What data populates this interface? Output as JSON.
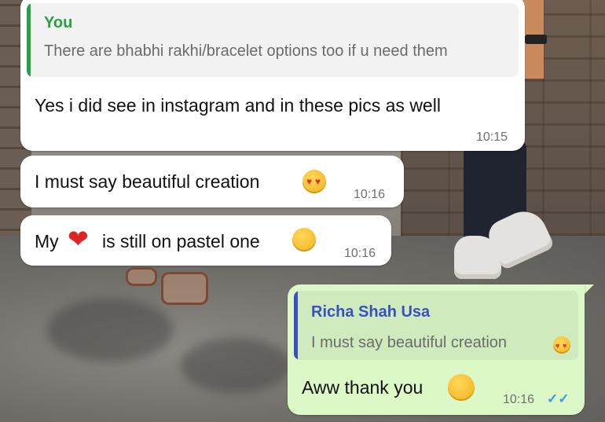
{
  "messages": [
    {
      "quote_author": "You",
      "quote_text": "There are bhabhi rakhi/bracelet options too if u need them",
      "text": "Yes i did see in instagram and in these pics as well",
      "time": "10:15"
    },
    {
      "text": "I must say beautiful creation",
      "emoji": "heart-eyes-emoji",
      "time": "10:16"
    },
    {
      "text_before": "My",
      "heart": "❤",
      "text_after": "is still on pastel one",
      "emoji": "shy-emoji",
      "time": "10:16"
    },
    {
      "quote_author": "Richa Shah Usa",
      "quote_text": "I must say beautiful creation",
      "quote_emoji": "heart-eyes-emoji",
      "text": "Aww thank you",
      "emoji": "smiling-emoji",
      "time": "10:16",
      "status": "✓✓"
    }
  ],
  "colors": {
    "incoming_bubble": "#ffffff",
    "outgoing_bubble": "#dcf8c6",
    "quote_you": "#25a244",
    "quote_other": "#3b4fc4",
    "read_ticks": "#3a98e0"
  }
}
